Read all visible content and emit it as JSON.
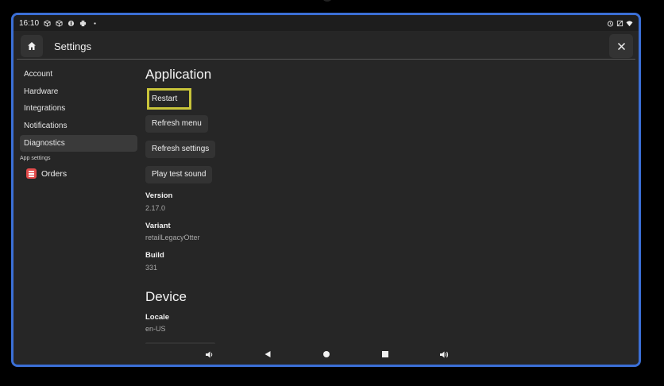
{
  "status_bar": {
    "time": "16:10",
    "left_icons": [
      "cube-icon",
      "cube-icon",
      "shield-icon",
      "printer-icon",
      "dot-icon"
    ],
    "right_icons": [
      "alarm-icon",
      "no-sim-icon",
      "wifi-icon"
    ]
  },
  "app_bar": {
    "home_icon": "home-icon",
    "title": "Settings",
    "close_icon": "close-icon"
  },
  "sidebar": {
    "items": [
      {
        "label": "Account",
        "active": false
      },
      {
        "label": "Hardware",
        "active": false
      },
      {
        "label": "Integrations",
        "active": false
      },
      {
        "label": "Notifications",
        "active": false
      },
      {
        "label": "Diagnostics",
        "active": true
      }
    ],
    "section_label": "App settings",
    "apps": [
      {
        "label": "Orders",
        "icon": "orders-icon",
        "accent": "#e24b4b"
      }
    ]
  },
  "content": {
    "application_heading": "Application",
    "buttons": {
      "restart": "Restart",
      "refresh_menu": "Refresh menu",
      "refresh_settings": "Refresh settings",
      "play_test_sound": "Play test sound"
    },
    "info": {
      "version_label": "Version",
      "version_value": "2.17.0",
      "variant_label": "Variant",
      "variant_value": "retailLegacyOtter",
      "build_label": "Build",
      "build_value": "331"
    },
    "device_heading": "Device",
    "device": {
      "locale_label": "Locale",
      "locale_value": "en-US"
    },
    "highlight_color": "#c8c43a"
  },
  "nav_bar": {
    "icons": [
      "volume-down-icon",
      "back-icon",
      "home-circle-icon",
      "recents-icon",
      "volume-up-icon"
    ]
  },
  "colors": {
    "frame": "#3b6fd6",
    "background": "#262626"
  }
}
